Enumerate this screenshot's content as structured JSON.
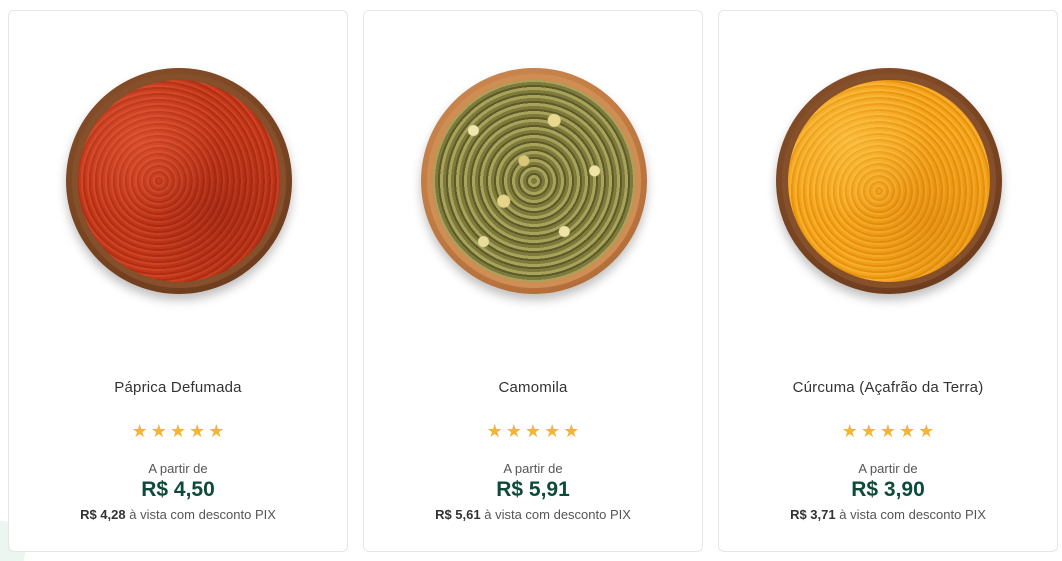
{
  "products": [
    {
      "name": "Páprica Defumada",
      "rating": 5,
      "from_label": "A partir de",
      "price": "R$ 4,50",
      "pix_price": "R$ 4,28",
      "pix_text": "à vista com desconto PIX",
      "image_icon": "paprika-bowl"
    },
    {
      "name": "Camomila",
      "rating": 5,
      "from_label": "A partir de",
      "price": "R$ 5,91",
      "pix_price": "R$ 5,61",
      "pix_text": "à vista com desconto PIX",
      "image_icon": "chamomile-bowl"
    },
    {
      "name": "Cúrcuma (Açafrão da Terra)",
      "rating": 5,
      "from_label": "A partir de",
      "price": "R$ 3,90",
      "pix_price": "R$ 3,71",
      "pix_text": "à vista com desconto PIX",
      "image_icon": "turmeric-bowl"
    }
  ],
  "colors": {
    "price": "#0e4a3a",
    "star": "#f2b534",
    "text": "#333333"
  }
}
